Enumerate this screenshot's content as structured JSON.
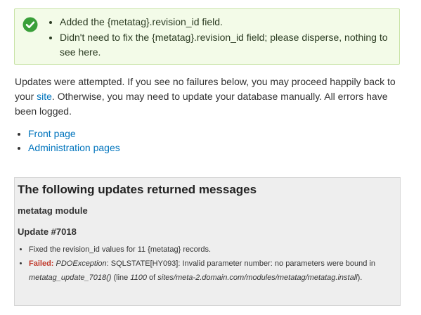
{
  "status": {
    "icon": "check-icon",
    "color": "#3a9f3a",
    "messages": [
      "Added the {metatag}.revision_id field.",
      "Didn't need to fix the {metatag}.revision_id field; please disperse, nothing to see here."
    ]
  },
  "intro": {
    "before_link": "Updates were attempted. If you see no failures below, you may proceed happily back to your ",
    "link_text": "site",
    "after_link": ". Otherwise, you may need to update your database manually. All errors have been logged."
  },
  "links": [
    "Front page",
    "Administration pages"
  ],
  "messages": {
    "heading": "The following updates returned messages",
    "module": "metatag module",
    "update": "Update #7018",
    "items": {
      "fixed": "Fixed the revision_id values for 11 {metatag} records.",
      "failed_label": "Failed:",
      "exception": "PDOException",
      "sql_text": ": SQLSTATE[HY093]: Invalid parameter number: no parameters were bound in ",
      "function": "metatag_update_7018()",
      "line_before": " (line ",
      "line_number": "1100",
      "line_of": " of ",
      "file": "sites/meta-2.domain.com/modules/metatag/metatag.install",
      "end": ")."
    }
  }
}
